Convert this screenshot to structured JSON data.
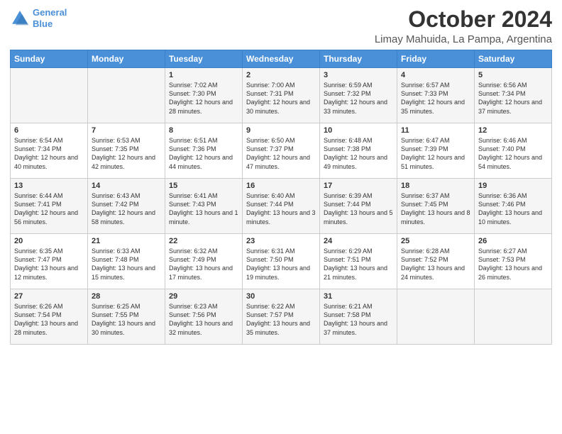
{
  "logo": {
    "line1": "General",
    "line2": "Blue"
  },
  "title": "October 2024",
  "subtitle": "Limay Mahuida, La Pampa, Argentina",
  "header_days": [
    "Sunday",
    "Monday",
    "Tuesday",
    "Wednesday",
    "Thursday",
    "Friday",
    "Saturday"
  ],
  "weeks": [
    [
      {
        "day": "",
        "sunrise": "",
        "sunset": "",
        "daylight": ""
      },
      {
        "day": "",
        "sunrise": "",
        "sunset": "",
        "daylight": ""
      },
      {
        "day": "1",
        "sunrise": "Sunrise: 7:02 AM",
        "sunset": "Sunset: 7:30 PM",
        "daylight": "Daylight: 12 hours and 28 minutes."
      },
      {
        "day": "2",
        "sunrise": "Sunrise: 7:00 AM",
        "sunset": "Sunset: 7:31 PM",
        "daylight": "Daylight: 12 hours and 30 minutes."
      },
      {
        "day": "3",
        "sunrise": "Sunrise: 6:59 AM",
        "sunset": "Sunset: 7:32 PM",
        "daylight": "Daylight: 12 hours and 33 minutes."
      },
      {
        "day": "4",
        "sunrise": "Sunrise: 6:57 AM",
        "sunset": "Sunset: 7:33 PM",
        "daylight": "Daylight: 12 hours and 35 minutes."
      },
      {
        "day": "5",
        "sunrise": "Sunrise: 6:56 AM",
        "sunset": "Sunset: 7:34 PM",
        "daylight": "Daylight: 12 hours and 37 minutes."
      }
    ],
    [
      {
        "day": "6",
        "sunrise": "Sunrise: 6:54 AM",
        "sunset": "Sunset: 7:34 PM",
        "daylight": "Daylight: 12 hours and 40 minutes."
      },
      {
        "day": "7",
        "sunrise": "Sunrise: 6:53 AM",
        "sunset": "Sunset: 7:35 PM",
        "daylight": "Daylight: 12 hours and 42 minutes."
      },
      {
        "day": "8",
        "sunrise": "Sunrise: 6:51 AM",
        "sunset": "Sunset: 7:36 PM",
        "daylight": "Daylight: 12 hours and 44 minutes."
      },
      {
        "day": "9",
        "sunrise": "Sunrise: 6:50 AM",
        "sunset": "Sunset: 7:37 PM",
        "daylight": "Daylight: 12 hours and 47 minutes."
      },
      {
        "day": "10",
        "sunrise": "Sunrise: 6:48 AM",
        "sunset": "Sunset: 7:38 PM",
        "daylight": "Daylight: 12 hours and 49 minutes."
      },
      {
        "day": "11",
        "sunrise": "Sunrise: 6:47 AM",
        "sunset": "Sunset: 7:39 PM",
        "daylight": "Daylight: 12 hours and 51 minutes."
      },
      {
        "day": "12",
        "sunrise": "Sunrise: 6:46 AM",
        "sunset": "Sunset: 7:40 PM",
        "daylight": "Daylight: 12 hours and 54 minutes."
      }
    ],
    [
      {
        "day": "13",
        "sunrise": "Sunrise: 6:44 AM",
        "sunset": "Sunset: 7:41 PM",
        "daylight": "Daylight: 12 hours and 56 minutes."
      },
      {
        "day": "14",
        "sunrise": "Sunrise: 6:43 AM",
        "sunset": "Sunset: 7:42 PM",
        "daylight": "Daylight: 12 hours and 58 minutes."
      },
      {
        "day": "15",
        "sunrise": "Sunrise: 6:41 AM",
        "sunset": "Sunset: 7:43 PM",
        "daylight": "Daylight: 13 hours and 1 minute."
      },
      {
        "day": "16",
        "sunrise": "Sunrise: 6:40 AM",
        "sunset": "Sunset: 7:44 PM",
        "daylight": "Daylight: 13 hours and 3 minutes."
      },
      {
        "day": "17",
        "sunrise": "Sunrise: 6:39 AM",
        "sunset": "Sunset: 7:44 PM",
        "daylight": "Daylight: 13 hours and 5 minutes."
      },
      {
        "day": "18",
        "sunrise": "Sunrise: 6:37 AM",
        "sunset": "Sunset: 7:45 PM",
        "daylight": "Daylight: 13 hours and 8 minutes."
      },
      {
        "day": "19",
        "sunrise": "Sunrise: 6:36 AM",
        "sunset": "Sunset: 7:46 PM",
        "daylight": "Daylight: 13 hours and 10 minutes."
      }
    ],
    [
      {
        "day": "20",
        "sunrise": "Sunrise: 6:35 AM",
        "sunset": "Sunset: 7:47 PM",
        "daylight": "Daylight: 13 hours and 12 minutes."
      },
      {
        "day": "21",
        "sunrise": "Sunrise: 6:33 AM",
        "sunset": "Sunset: 7:48 PM",
        "daylight": "Daylight: 13 hours and 15 minutes."
      },
      {
        "day": "22",
        "sunrise": "Sunrise: 6:32 AM",
        "sunset": "Sunset: 7:49 PM",
        "daylight": "Daylight: 13 hours and 17 minutes."
      },
      {
        "day": "23",
        "sunrise": "Sunrise: 6:31 AM",
        "sunset": "Sunset: 7:50 PM",
        "daylight": "Daylight: 13 hours and 19 minutes."
      },
      {
        "day": "24",
        "sunrise": "Sunrise: 6:29 AM",
        "sunset": "Sunset: 7:51 PM",
        "daylight": "Daylight: 13 hours and 21 minutes."
      },
      {
        "day": "25",
        "sunrise": "Sunrise: 6:28 AM",
        "sunset": "Sunset: 7:52 PM",
        "daylight": "Daylight: 13 hours and 24 minutes."
      },
      {
        "day": "26",
        "sunrise": "Sunrise: 6:27 AM",
        "sunset": "Sunset: 7:53 PM",
        "daylight": "Daylight: 13 hours and 26 minutes."
      }
    ],
    [
      {
        "day": "27",
        "sunrise": "Sunrise: 6:26 AM",
        "sunset": "Sunset: 7:54 PM",
        "daylight": "Daylight: 13 hours and 28 minutes."
      },
      {
        "day": "28",
        "sunrise": "Sunrise: 6:25 AM",
        "sunset": "Sunset: 7:55 PM",
        "daylight": "Daylight: 13 hours and 30 minutes."
      },
      {
        "day": "29",
        "sunrise": "Sunrise: 6:23 AM",
        "sunset": "Sunset: 7:56 PM",
        "daylight": "Daylight: 13 hours and 32 minutes."
      },
      {
        "day": "30",
        "sunrise": "Sunrise: 6:22 AM",
        "sunset": "Sunset: 7:57 PM",
        "daylight": "Daylight: 13 hours and 35 minutes."
      },
      {
        "day": "31",
        "sunrise": "Sunrise: 6:21 AM",
        "sunset": "Sunset: 7:58 PM",
        "daylight": "Daylight: 13 hours and 37 minutes."
      },
      {
        "day": "",
        "sunrise": "",
        "sunset": "",
        "daylight": ""
      },
      {
        "day": "",
        "sunrise": "",
        "sunset": "",
        "daylight": ""
      }
    ]
  ]
}
